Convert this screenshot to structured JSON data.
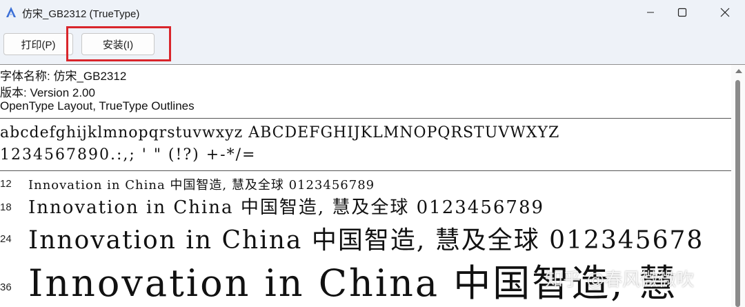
{
  "window": {
    "title": "仿宋_GB2312 (TrueType)",
    "app_icon": "font-viewer-icon",
    "controls": {
      "minimize": "minimize-icon",
      "maximize": "maximize-icon",
      "close": "close-icon"
    }
  },
  "toolbar": {
    "print_label": "打印(P)",
    "install_label": "安装(I)"
  },
  "font_info": {
    "name_line": "字体名称: 仿宋_GB2312",
    "version_line": "版本: Version 2.00",
    "type_line": "OpenType Layout, TrueType Outlines"
  },
  "charset": {
    "letters": "abcdefghijklmnopqrstuvwxyz ABCDEFGHIJKLMNOPQRSTUVWXYZ",
    "digits_symbols": "1234567890.:,; ' \" (!?) +-*/="
  },
  "samples": [
    {
      "size": "12",
      "text": "Innovation in China 中国智造, 慧及全球 0123456789"
    },
    {
      "size": "18",
      "text": "Innovation in China 中国智造, 慧及全球 0123456789"
    },
    {
      "size": "24",
      "text": "Innovation in China 中国智造, 慧及全球 012345678"
    },
    {
      "size": "36",
      "text": "Innovation in China 中国智造, 慧"
    }
  ],
  "watermark": "知乎 @春风微微吹",
  "colors": {
    "highlight_border": "#d9252b",
    "chrome_bg": "#eef2f8"
  }
}
